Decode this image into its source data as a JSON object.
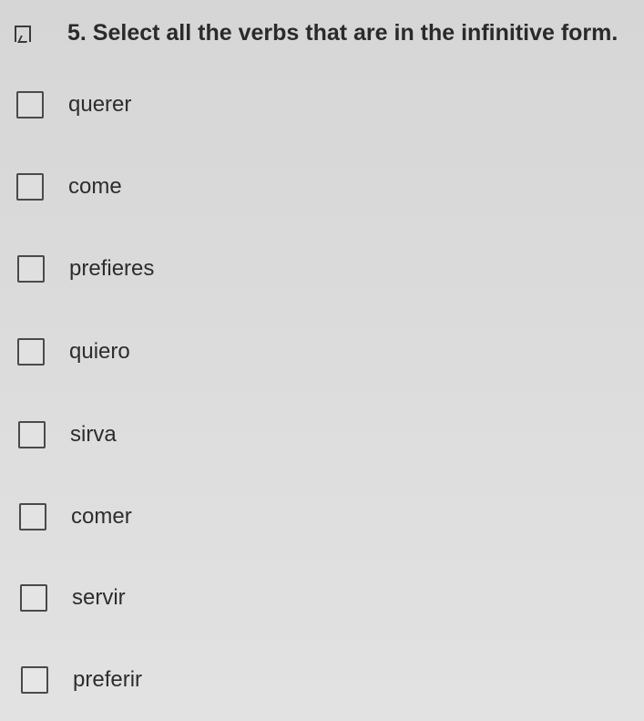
{
  "question": {
    "text": "5. Select all the verbs that are in the infinitive form."
  },
  "options": [
    {
      "label": "querer",
      "checked": false
    },
    {
      "label": "come",
      "checked": false
    },
    {
      "label": "prefieres",
      "checked": false
    },
    {
      "label": "quiero",
      "checked": false
    },
    {
      "label": "sirva",
      "checked": false
    },
    {
      "label": "comer",
      "checked": false
    },
    {
      "label": "servir",
      "checked": false
    },
    {
      "label": "preferir",
      "checked": false
    }
  ]
}
